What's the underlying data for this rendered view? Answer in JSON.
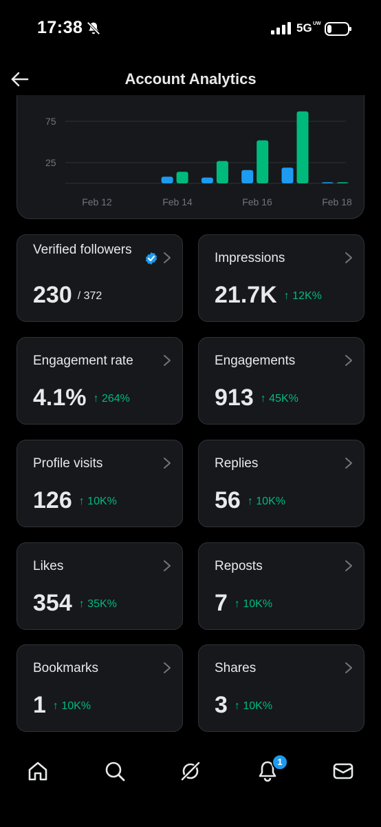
{
  "status_bar": {
    "time": "17:38",
    "network": "5G",
    "network_sub": "UW"
  },
  "header": {
    "title": "Account Analytics"
  },
  "chart_data": {
    "type": "bar",
    "y_ticks": [
      "75",
      "25"
    ],
    "x_tick_labels": [
      "Feb 12",
      "Feb 14",
      "Feb 16",
      "Feb 18"
    ],
    "categories": [
      "Feb 12",
      "Feb 13",
      "Feb 14",
      "Feb 15",
      "Feb 16",
      "Feb 17",
      "Feb 18"
    ],
    "series": [
      {
        "color": "#1d9bf0",
        "values": [
          0,
          0,
          8,
          7,
          16,
          19,
          1
        ]
      },
      {
        "color": "#00ba7c",
        "values": [
          0,
          0,
          14,
          27,
          52,
          87,
          1
        ]
      }
    ],
    "ylim": [
      0,
      90
    ]
  },
  "stats": [
    {
      "title": "Verified followers",
      "value": "230",
      "sub": "/ 372",
      "delta": "",
      "verified": true
    },
    {
      "title": "Impressions",
      "value": "21.7K",
      "sub": "",
      "delta": "↑ 12K%"
    },
    {
      "title": "Engagement rate",
      "value": "4.1%",
      "sub": "",
      "delta": "↑ 264%"
    },
    {
      "title": "Engagements",
      "value": "913",
      "sub": "",
      "delta": "↑ 45K%"
    },
    {
      "title": "Profile visits",
      "value": "126",
      "sub": "",
      "delta": "↑ 10K%"
    },
    {
      "title": "Replies",
      "value": "56",
      "sub": "",
      "delta": "↑ 10K%"
    },
    {
      "title": "Likes",
      "value": "354",
      "sub": "",
      "delta": "↑ 35K%"
    },
    {
      "title": "Reposts",
      "value": "7",
      "sub": "",
      "delta": "↑ 10K%"
    },
    {
      "title": "Bookmarks",
      "value": "1",
      "sub": "",
      "delta": "↑ 10K%"
    },
    {
      "title": "Shares",
      "value": "3",
      "sub": "",
      "delta": "↑ 10K%"
    }
  ],
  "bottom_nav": {
    "items": [
      "home-icon",
      "search-icon",
      "grok-icon",
      "notifications-icon",
      "messages-icon"
    ],
    "notification_count": "1"
  },
  "colors": {
    "accent_blue": "#1d9bf0",
    "accent_green": "#00ba7c",
    "card_bg": "#16181c",
    "border": "#2f3336"
  }
}
